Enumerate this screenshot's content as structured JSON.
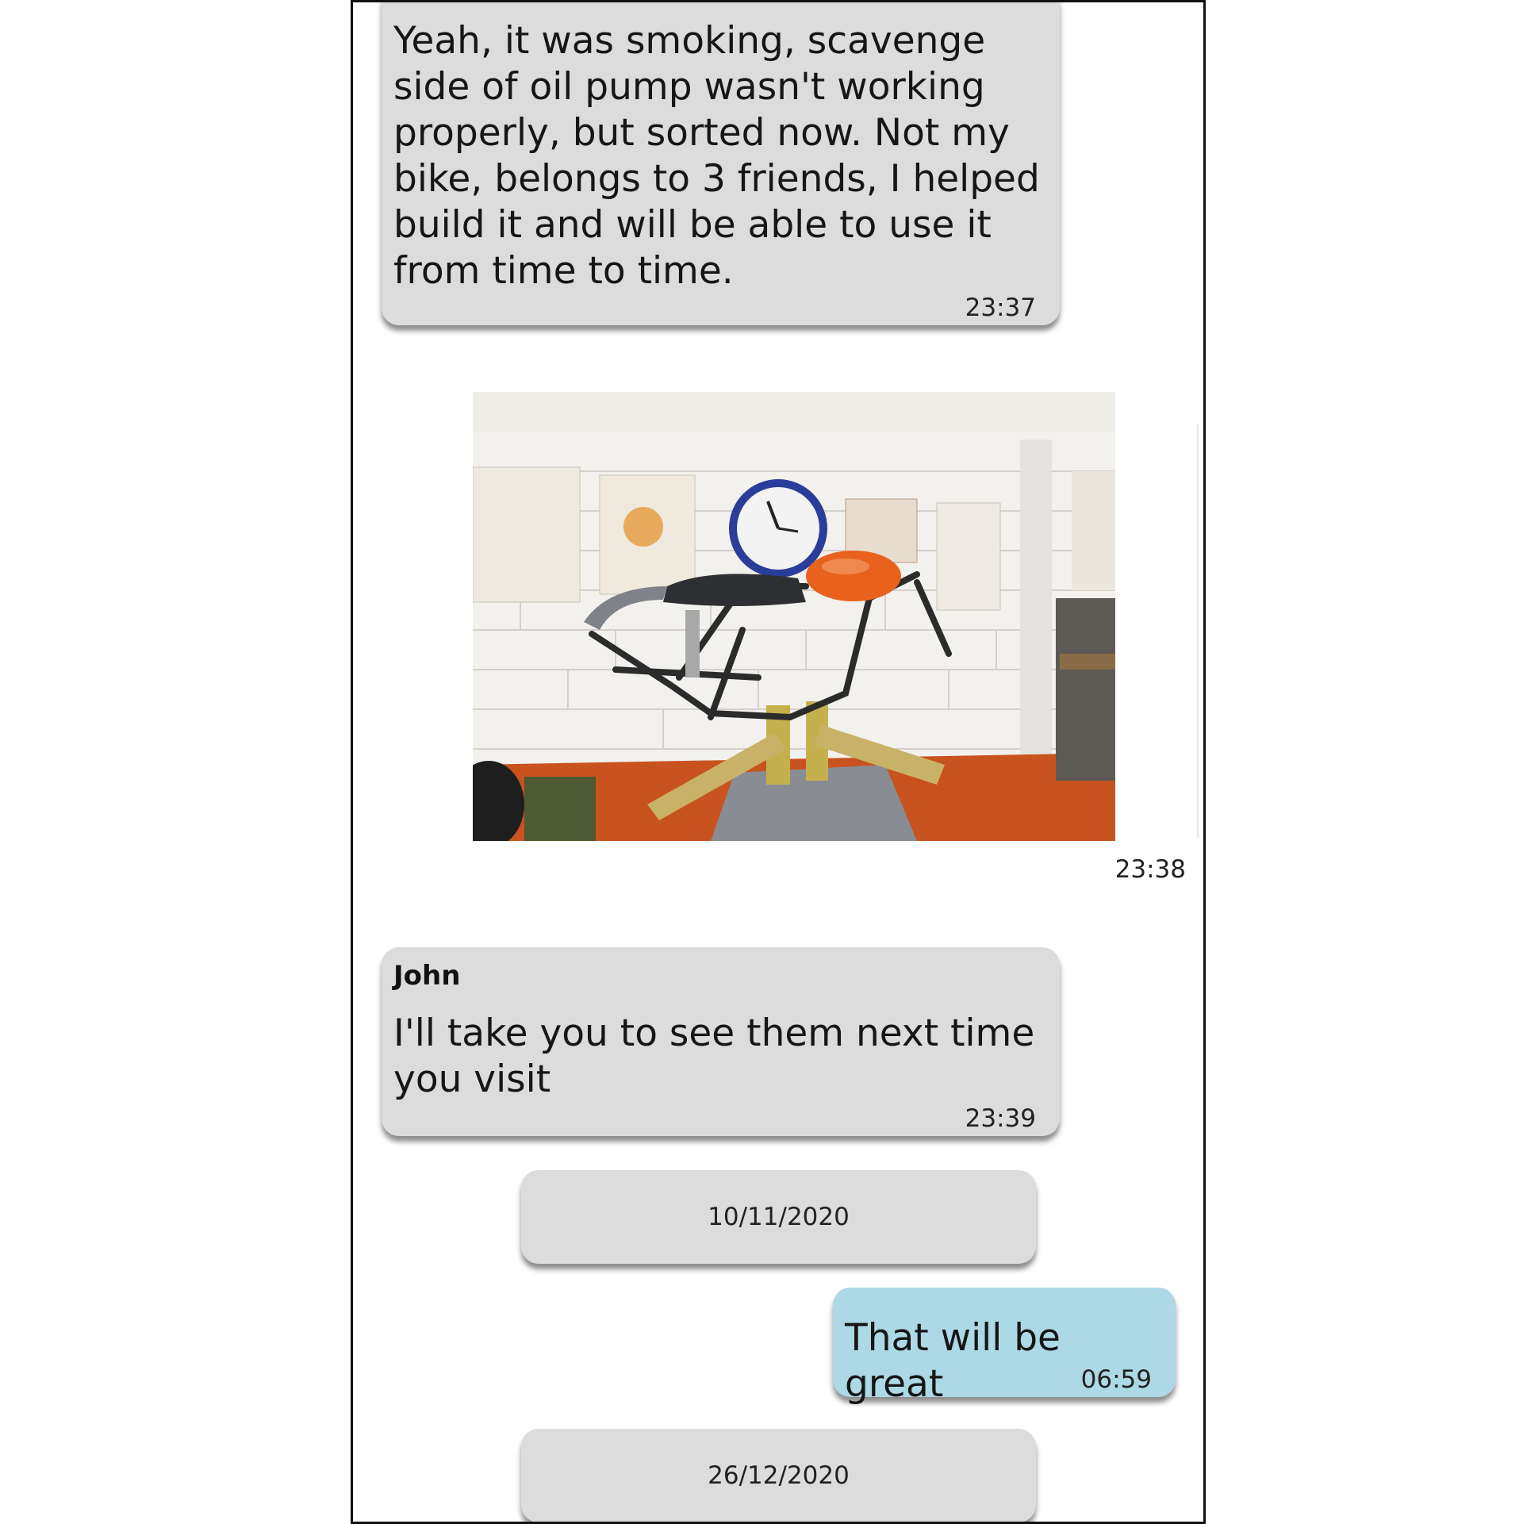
{
  "messages": [
    {
      "text": "Yeah, it was smoking, scavenge\nside of oil pump wasn't working\nproperly, but sorted now. Not my\nbike, belongs to 3 friends, I helped\nbuild it and will be able to use it\nfrom time to time.",
      "time": "23:37"
    },
    {
      "image_desc": "motorcycle-frame-photo",
      "time": "23:38"
    },
    {
      "sender": "John",
      "text": "I'll take you to see them next time\nyou visit",
      "time": "23:39"
    },
    {
      "date": "10/11/2020"
    },
    {
      "text": "That will be great",
      "time": "06:59"
    },
    {
      "date": "26/12/2020"
    }
  ],
  "colors": {
    "incoming_bubble": "#dcdcdc",
    "outgoing_bubble": "#add8e6",
    "date_pill": "#dcdcdc"
  }
}
